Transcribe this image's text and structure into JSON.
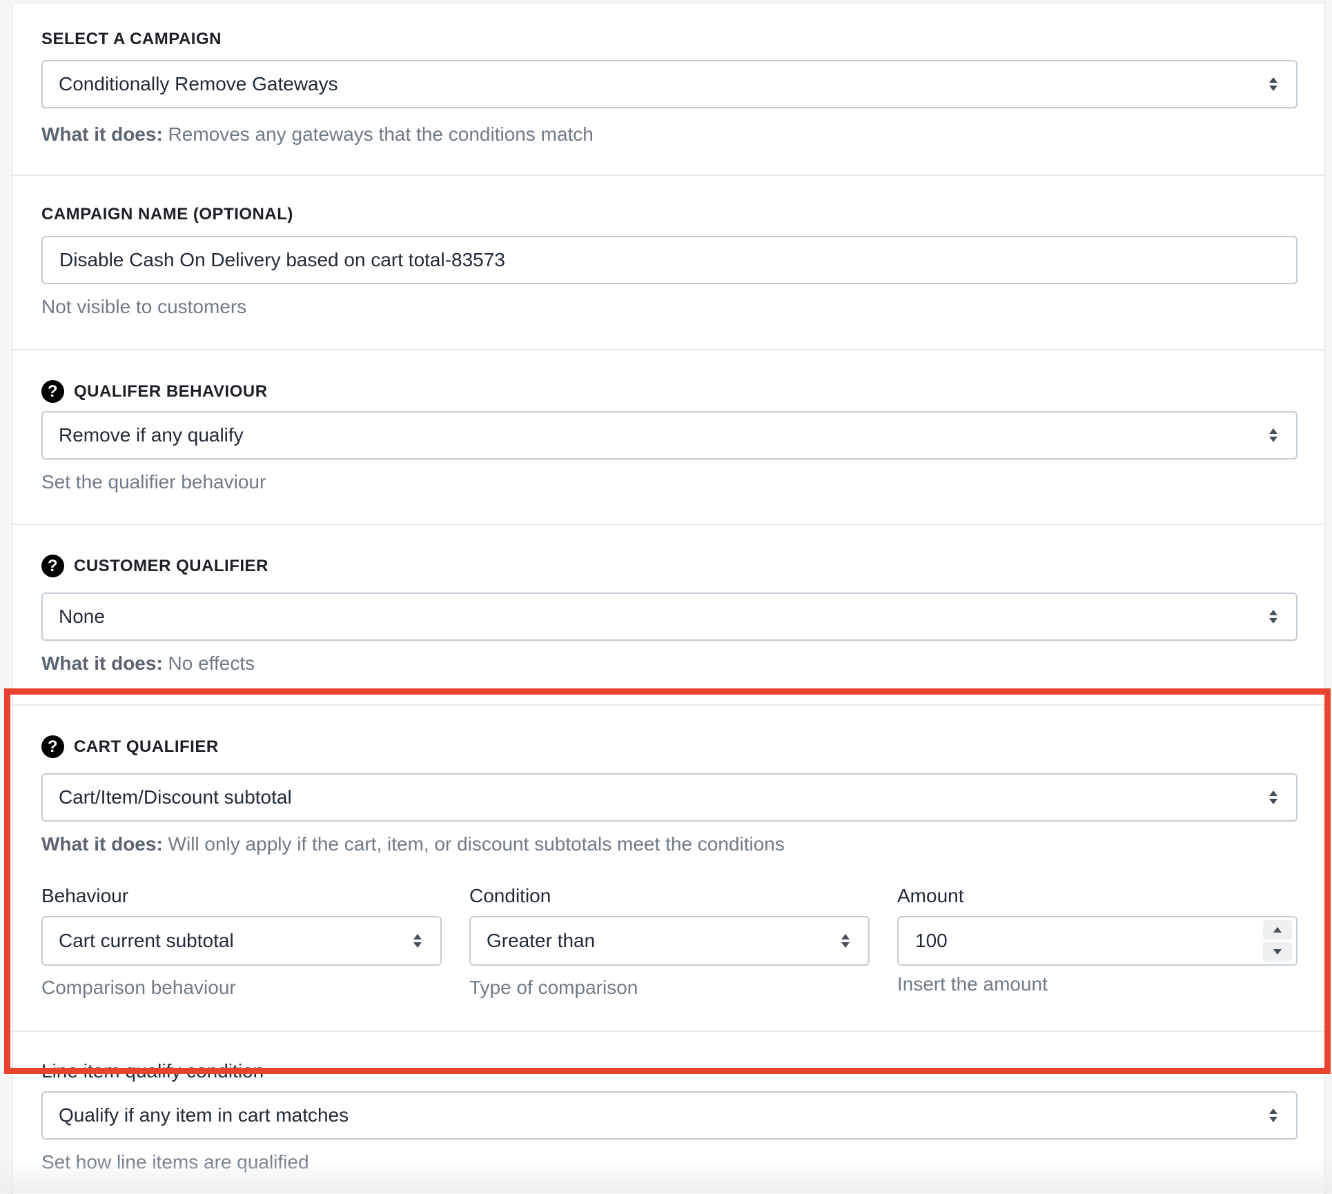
{
  "campaign": {
    "label": "SELECT A CAMPAIGN",
    "selected": "Conditionally Remove Gateways",
    "what_it_does_label": "What it does:",
    "what_it_does_text": " Removes any gateways that the conditions match"
  },
  "campaign_name": {
    "label": "CAMPAIGN NAME (OPTIONAL)",
    "value": "Disable Cash On Delivery based on cart total-83573",
    "help": "Not visible to customers"
  },
  "qualifier_behaviour": {
    "label": "QUALIFER BEHAVIOUR",
    "selected": "Remove if any qualify",
    "help": "Set the qualifier behaviour"
  },
  "customer_qualifier": {
    "label": "CUSTOMER QUALIFIER",
    "selected": "None",
    "what_it_does_label": "What it does:",
    "what_it_does_text": " No effects"
  },
  "cart_qualifier": {
    "label": "CART QUALIFIER",
    "selected": "Cart/Item/Discount subtotal",
    "what_it_does_label": "What it does:",
    "what_it_does_text": " Will only apply if the cart, item, or discount subtotals meet the conditions",
    "behaviour": {
      "label": "Behaviour",
      "selected": "Cart current subtotal",
      "help": "Comparison behaviour"
    },
    "condition": {
      "label": "Condition",
      "selected": "Greater than",
      "help": "Type of comparison"
    },
    "amount": {
      "label": "Amount",
      "value": "100",
      "help": "Insert the amount"
    }
  },
  "line_item": {
    "label": "Line item qualify condition",
    "selected": "Qualify if any item in cart matches",
    "help": "Set how line items are qualified"
  },
  "icons": {
    "help": "question-circle-icon",
    "select": "select-caret-icon"
  },
  "colors": {
    "highlight": "#e8432e",
    "border": "#c4cdd5",
    "help_text": "#6f7b86"
  }
}
